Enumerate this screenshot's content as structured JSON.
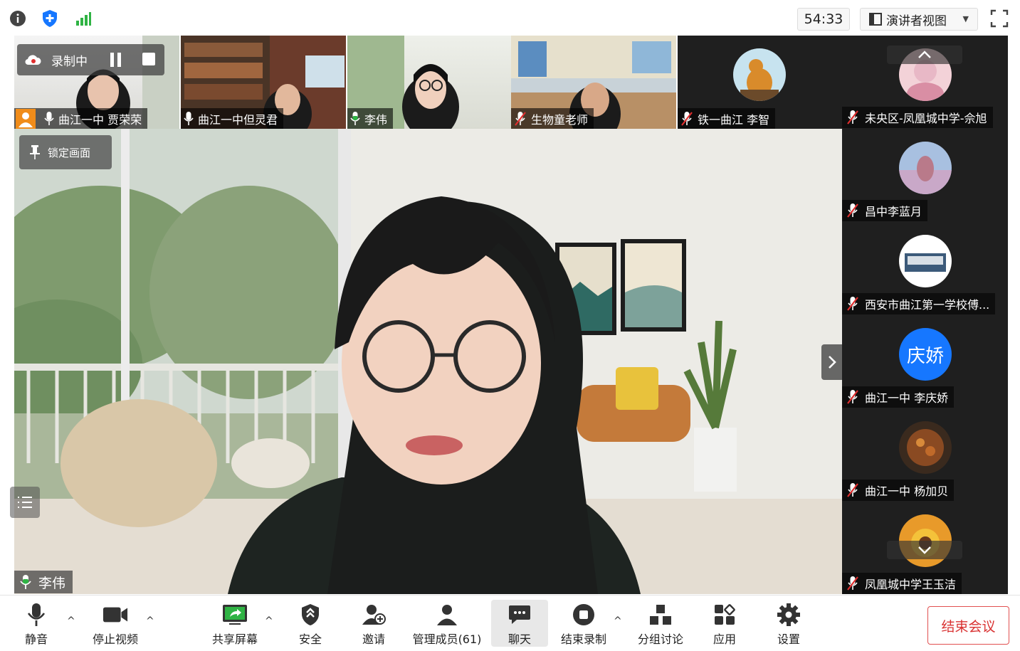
{
  "topbar": {
    "timer": "54:33",
    "view_mode": "演讲者视图"
  },
  "recording": {
    "status": "录制中"
  },
  "main_video": {
    "lock_label": "锁定画面",
    "speaker": "李伟"
  },
  "top_tiles": [
    {
      "name": "曲江一中 贾荣荣",
      "muted": false
    },
    {
      "name": "曲江一中但灵君",
      "muted": false
    },
    {
      "name": "李伟",
      "muted": false,
      "speaking": true
    },
    {
      "name": "生物童老师",
      "muted": true
    },
    {
      "name": "铁一曲江 李智",
      "muted": true
    }
  ],
  "side_tiles": [
    {
      "name": "未央区-凤凰城中学-佘旭",
      "muted": true
    },
    {
      "name": "昌中李蓝月",
      "muted": true
    },
    {
      "name": "西安市曲江第一学校傅...",
      "muted": true
    },
    {
      "name": "曲江一中 李庆娇",
      "muted": true,
      "avatar_text": "庆娇",
      "avatar_color": "#1677ff"
    },
    {
      "name": "曲江一中 杨加贝",
      "muted": true
    },
    {
      "name": "凤凰城中学王玉洁",
      "muted": true
    }
  ],
  "toolbar": {
    "mute": "静音",
    "stop_video": "停止视频",
    "share_screen": "共享屏幕",
    "security": "安全",
    "invite": "邀请",
    "manage_members": "管理成员(61)",
    "chat": "聊天",
    "end_recording": "结束录制",
    "breakout": "分组讨论",
    "apps": "应用",
    "settings": "设置",
    "end_meeting": "结束会议"
  },
  "colors": {
    "accent": "#1677ff",
    "end_meeting": "#d93333",
    "signal": "#2fb344",
    "shield": "#1677ff",
    "muted_red": "#e02e2e"
  }
}
